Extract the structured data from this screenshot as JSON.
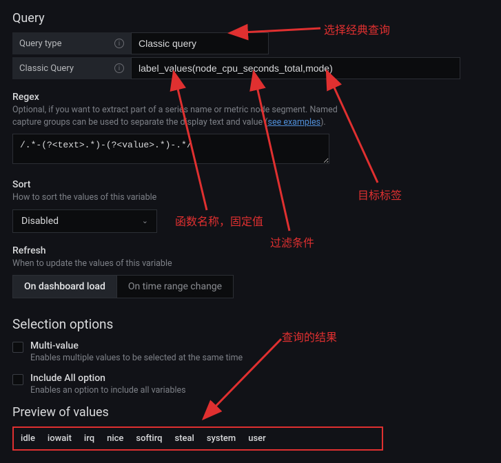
{
  "section": {
    "title": "Query"
  },
  "query_type": {
    "label": "Query type",
    "value": "Classic query"
  },
  "classic_query": {
    "label": "Classic Query",
    "value": "label_values(node_cpu_seconds_total,mode)"
  },
  "regex": {
    "title": "Regex",
    "help_pre": "Optional, if you want to extract part of a series name or metric node segment. Named capture groups can be used to separate the display text and value (",
    "help_link": "see examples",
    "help_post": ").",
    "value": "/.*-(?<text>.*)-(?<value>.*)-.*/"
  },
  "sort": {
    "title": "Sort",
    "help": "How to sort the values of this variable",
    "value": "Disabled"
  },
  "refresh": {
    "title": "Refresh",
    "help": "When to update the values of this variable",
    "options": [
      "On dashboard load",
      "On time range change"
    ],
    "active_index": 0
  },
  "selection": {
    "title": "Selection options",
    "multi": {
      "label": "Multi-value",
      "desc": "Enables multiple values to be selected at the same time"
    },
    "include_all": {
      "label": "Include All option",
      "desc": "Enables an option to include all variables"
    }
  },
  "preview": {
    "title": "Preview of values",
    "values": [
      "idle",
      "iowait",
      "irq",
      "nice",
      "softirq",
      "steal",
      "system",
      "user"
    ]
  },
  "annotations": {
    "a1": "选择经典查询",
    "a2": "目标标签",
    "a3": "函数名称，固定值",
    "a4": "过滤条件",
    "a5": "查询的结果"
  }
}
